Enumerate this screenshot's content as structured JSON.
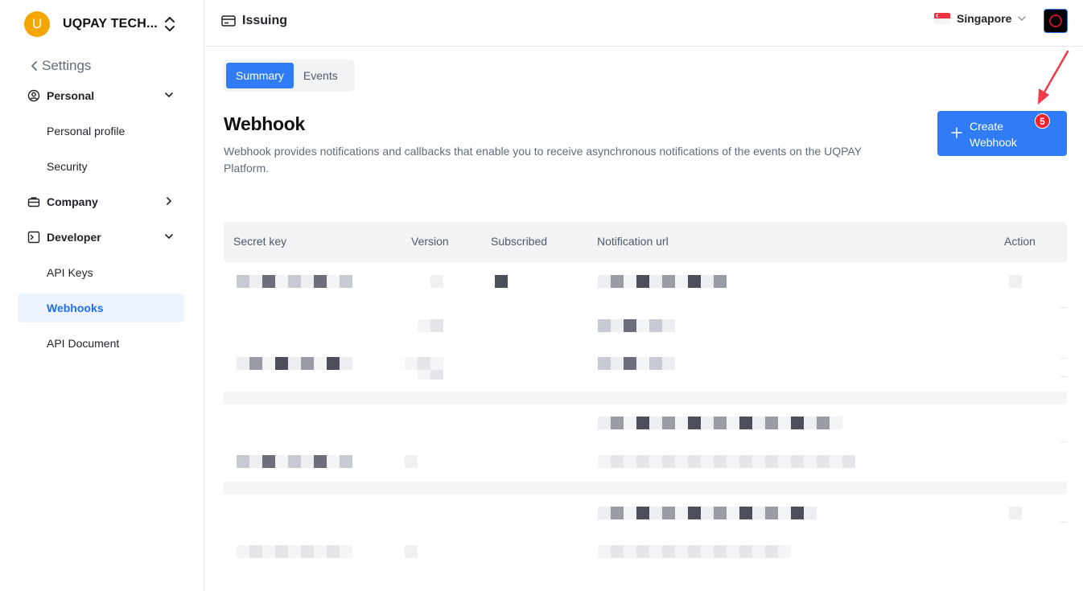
{
  "sidebar": {
    "org_initial": "U",
    "org_name": "UQPAY TECH...",
    "back_label": "Settings",
    "groups": [
      {
        "label": "Personal",
        "icon": "user-circle-icon",
        "expanded": true
      },
      {
        "label": "Company",
        "icon": "briefcase-icon",
        "expanded": false
      },
      {
        "label": "Developer",
        "icon": "terminal-icon",
        "expanded": true
      }
    ],
    "items": {
      "personal_profile": "Personal profile",
      "security": "Security",
      "api_keys": "API Keys",
      "webhooks": "Webhooks",
      "api_document": "API Document"
    }
  },
  "header": {
    "title": "Issuing",
    "region": "Singapore"
  },
  "tabs": [
    {
      "label": "Summary",
      "active": true
    },
    {
      "label": "Events",
      "active": false
    }
  ],
  "main": {
    "title": "Webhook",
    "description": "Webhook provides notifications and callbacks that enable you to receive asynchronous notifications of the events on the UQPAY Platform.",
    "create_button": "Create Webhook",
    "badge": "5"
  },
  "table": {
    "columns": [
      "Secret key",
      "Version",
      "Subscribed",
      "Notification url",
      "Action"
    ]
  },
  "colors": {
    "accent": "#2f7cf6",
    "org_avatar": "#f5a600",
    "badge": "#f5222d",
    "active_bg": "#eef4ff"
  }
}
